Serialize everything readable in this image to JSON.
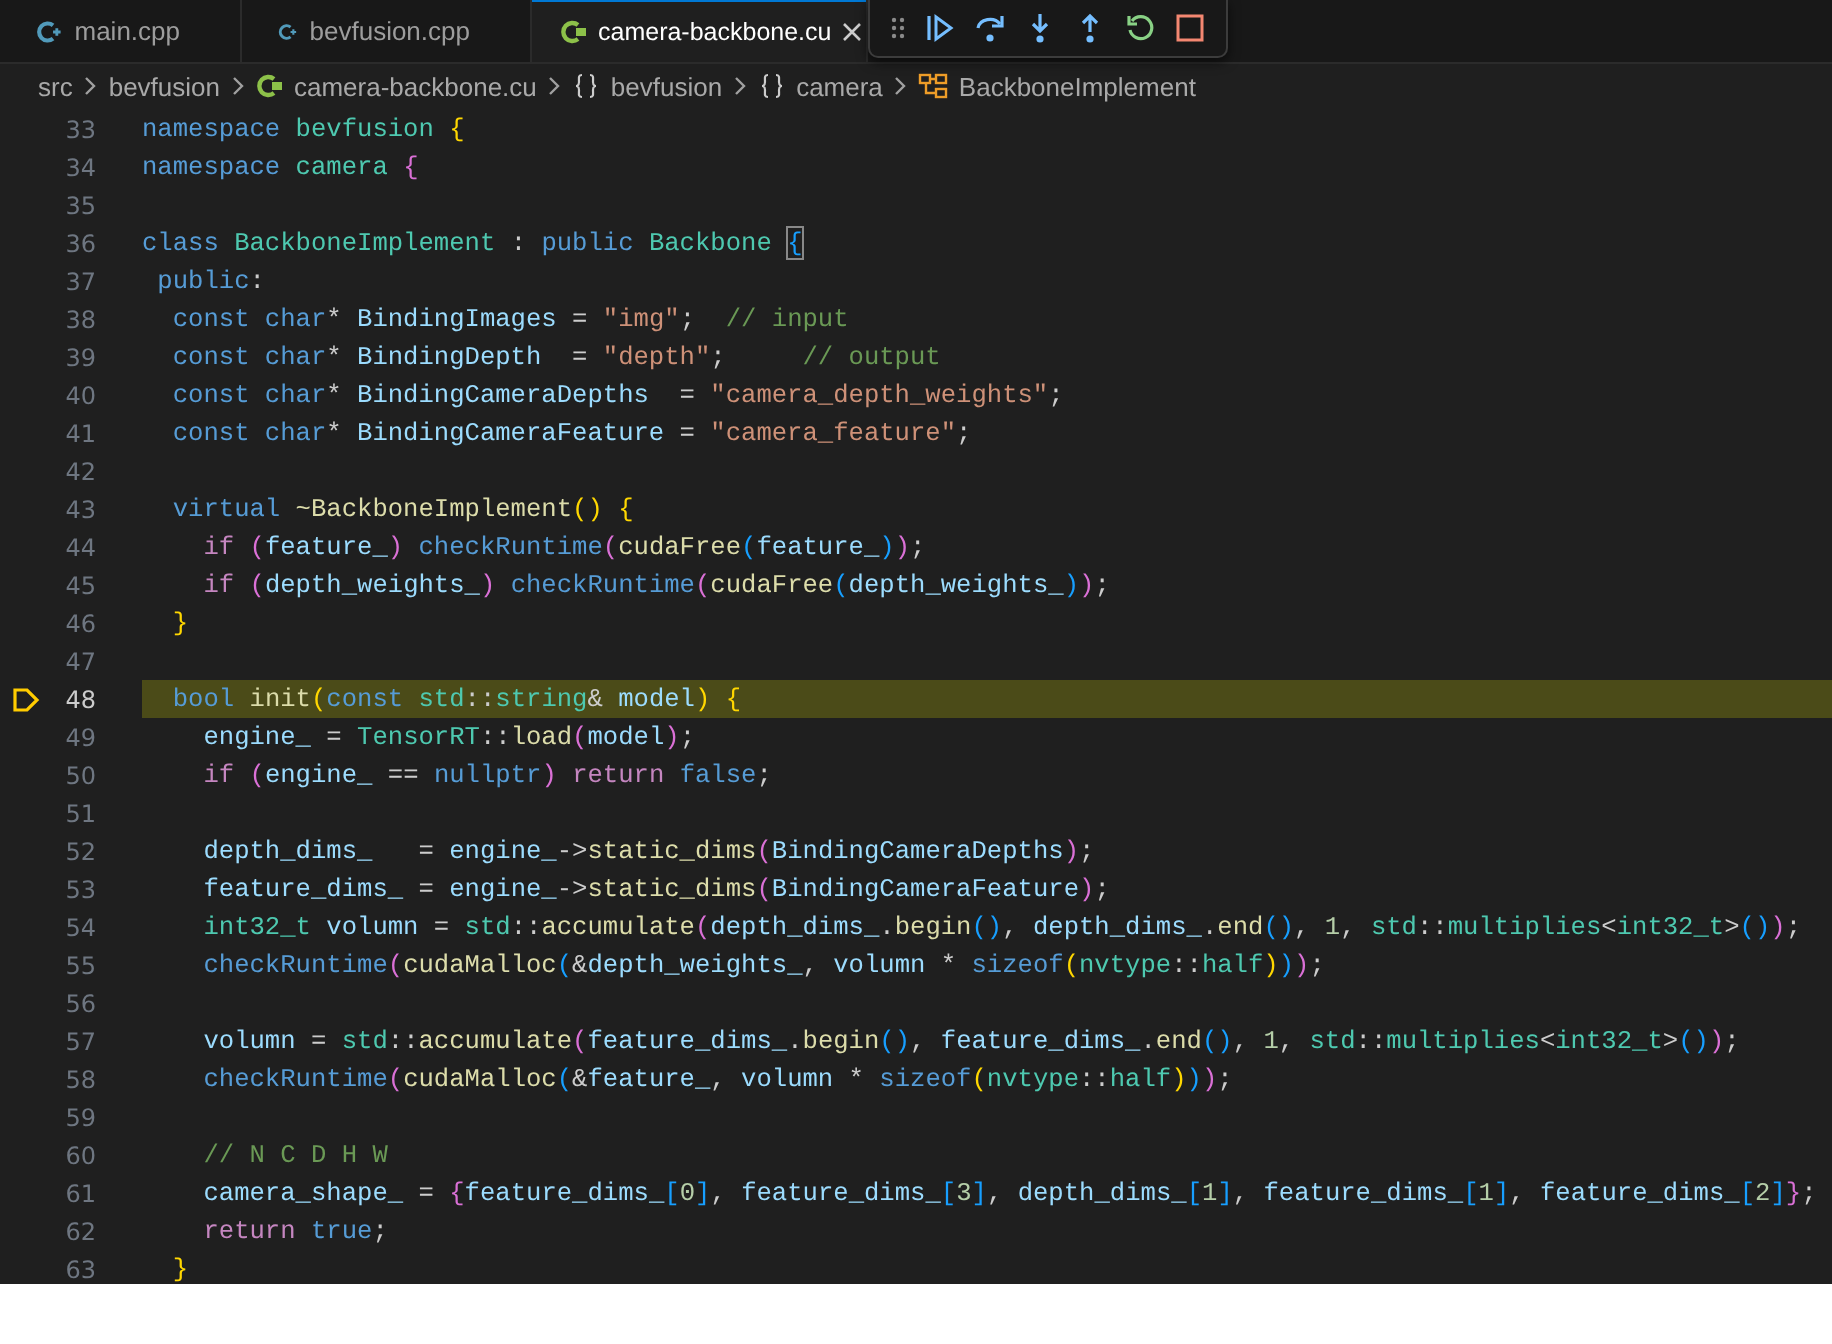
{
  "tabs": [
    {
      "label": "main.cpp",
      "kind": "cpp",
      "selected": false
    },
    {
      "label": "bevfusion.cpp",
      "kind": "cpp",
      "selected": false
    },
    {
      "label": "camera-backbone.cu",
      "kind": "cuda",
      "selected": true
    }
  ],
  "debug_toolbar": [
    {
      "kind": "continue"
    },
    {
      "kind": "step_over"
    },
    {
      "kind": "step_into"
    },
    {
      "kind": "step_out"
    },
    {
      "kind": "restart"
    },
    {
      "kind": "stop"
    }
  ],
  "breadcrumbs": [
    {
      "label": "src",
      "kind": "folder"
    },
    {
      "label": "bevfusion",
      "kind": "folder"
    },
    {
      "label": "camera-backbone.cu",
      "kind": "cuda"
    },
    {
      "label": "bevfusion",
      "kind": "namespace"
    },
    {
      "label": "camera",
      "kind": "namespace"
    },
    {
      "label": "BackboneImplement",
      "kind": "class"
    }
  ],
  "lines": [
    {
      "number": "33",
      "current": false,
      "tokens": [
        {
          "kind": "kw",
          "text": "namespace "
        },
        {
          "kind": "type",
          "text": "bevfusion "
        },
        {
          "kind": "b1",
          "text": "{"
        }
      ]
    },
    {
      "number": "34",
      "current": false,
      "tokens": [
        {
          "kind": "kw",
          "text": "namespace "
        },
        {
          "kind": "type",
          "text": "camera "
        },
        {
          "kind": "b2",
          "text": "{"
        }
      ]
    },
    {
      "number": "35",
      "current": false
    },
    {
      "number": "36",
      "current": false,
      "tokens": [
        {
          "kind": "kw",
          "text": "class "
        },
        {
          "kind": "type",
          "text": "BackboneImplement"
        },
        {
          "kind": "p",
          "text": " : "
        },
        {
          "kind": "kw",
          "text": "public "
        },
        {
          "kind": "type",
          "text": "Backbone "
        },
        {
          "kind": "bm",
          "text": "{"
        }
      ]
    },
    {
      "number": "37",
      "current": false,
      "tokens": [
        {
          "kind": "kw",
          "text": " public"
        },
        {
          "kind": "p",
          "text": ":"
        }
      ]
    },
    {
      "number": "38",
      "current": false,
      "tokens": [
        {
          "kind": "kw",
          "text": "  const char"
        },
        {
          "kind": "p",
          "text": "* "
        },
        {
          "kind": "var",
          "text": "BindingImages"
        },
        {
          "kind": "p",
          "text": " = "
        },
        {
          "kind": "str",
          "text": "\"img\""
        },
        {
          "kind": "p",
          "text": ";  "
        },
        {
          "kind": "com",
          "text": "// input"
        }
      ]
    },
    {
      "number": "39",
      "current": false,
      "tokens": [
        {
          "kind": "kw",
          "text": "  const char"
        },
        {
          "kind": "p",
          "text": "* "
        },
        {
          "kind": "var",
          "text": "BindingDepth"
        },
        {
          "kind": "p",
          "text": "  = "
        },
        {
          "kind": "str",
          "text": "\"depth\""
        },
        {
          "kind": "p",
          "text": ";     "
        },
        {
          "kind": "com",
          "text": "// output"
        }
      ]
    },
    {
      "number": "40",
      "current": false,
      "tokens": [
        {
          "kind": "kw",
          "text": "  const char"
        },
        {
          "kind": "p",
          "text": "* "
        },
        {
          "kind": "var",
          "text": "BindingCameraDepths"
        },
        {
          "kind": "p",
          "text": "  = "
        },
        {
          "kind": "str",
          "text": "\"camera_depth_weights\""
        },
        {
          "kind": "p",
          "text": ";"
        }
      ]
    },
    {
      "number": "41",
      "current": false,
      "tokens": [
        {
          "kind": "kw",
          "text": "  const char"
        },
        {
          "kind": "p",
          "text": "* "
        },
        {
          "kind": "var",
          "text": "BindingCameraFeature"
        },
        {
          "kind": "p",
          "text": " = "
        },
        {
          "kind": "str",
          "text": "\"camera_feature\""
        },
        {
          "kind": "p",
          "text": ";"
        }
      ]
    },
    {
      "number": "42",
      "current": false
    },
    {
      "number": "43",
      "current": false,
      "tokens": [
        {
          "kind": "kw",
          "text": "  virtual "
        },
        {
          "kind": "fn",
          "text": "~BackboneImplement"
        },
        {
          "kind": "b1",
          "text": "() {"
        }
      ]
    },
    {
      "number": "44",
      "current": false,
      "tokens": [
        {
          "kind": "ctrl",
          "text": "    if "
        },
        {
          "kind": "b2",
          "text": "("
        },
        {
          "kind": "var",
          "text": "feature_"
        },
        {
          "kind": "b2",
          "text": ") "
        },
        {
          "kind": "kw",
          "text": "checkRuntime"
        },
        {
          "kind": "b2",
          "text": "("
        },
        {
          "kind": "fn",
          "text": "cudaFree"
        },
        {
          "kind": "b3",
          "text": "("
        },
        {
          "kind": "var",
          "text": "feature_"
        },
        {
          "kind": "b3",
          "text": ")"
        },
        {
          "kind": "b2",
          "text": ")"
        },
        {
          "kind": "p",
          "text": ";"
        }
      ]
    },
    {
      "number": "45",
      "current": false,
      "tokens": [
        {
          "kind": "ctrl",
          "text": "    if "
        },
        {
          "kind": "b2",
          "text": "("
        },
        {
          "kind": "var",
          "text": "depth_weights_"
        },
        {
          "kind": "b2",
          "text": ") "
        },
        {
          "kind": "kw",
          "text": "checkRuntime"
        },
        {
          "kind": "b2",
          "text": "("
        },
        {
          "kind": "fn",
          "text": "cudaFree"
        },
        {
          "kind": "b3",
          "text": "("
        },
        {
          "kind": "var",
          "text": "depth_weights_"
        },
        {
          "kind": "b3",
          "text": ")"
        },
        {
          "kind": "b2",
          "text": ")"
        },
        {
          "kind": "p",
          "text": ";"
        }
      ]
    },
    {
      "number": "46",
      "current": false,
      "tokens": [
        {
          "kind": "b1",
          "text": "  }"
        }
      ]
    },
    {
      "number": "47",
      "current": false
    },
    {
      "number": "48",
      "current": true,
      "tokens": [
        {
          "kind": "kw",
          "text": "  bool "
        },
        {
          "kind": "fn",
          "text": "init"
        },
        {
          "kind": "b1",
          "text": "("
        },
        {
          "kind": "kw",
          "text": "const "
        },
        {
          "kind": "type",
          "text": "std"
        },
        {
          "kind": "p",
          "text": "::"
        },
        {
          "kind": "type",
          "text": "string"
        },
        {
          "kind": "p",
          "text": "& "
        },
        {
          "kind": "var",
          "text": "model"
        },
        {
          "kind": "b1",
          "text": ") {"
        }
      ]
    },
    {
      "number": "49",
      "current": false,
      "tokens": [
        {
          "kind": "var",
          "text": "    engine_"
        },
        {
          "kind": "p",
          "text": " = "
        },
        {
          "kind": "type",
          "text": "TensorRT"
        },
        {
          "kind": "p",
          "text": "::"
        },
        {
          "kind": "fn",
          "text": "load"
        },
        {
          "kind": "b2",
          "text": "("
        },
        {
          "kind": "var",
          "text": "model"
        },
        {
          "kind": "b2",
          "text": ")"
        },
        {
          "kind": "p",
          "text": ";"
        }
      ]
    },
    {
      "number": "50",
      "current": false,
      "tokens": [
        {
          "kind": "ctrl",
          "text": "    if "
        },
        {
          "kind": "b2",
          "text": "("
        },
        {
          "kind": "var",
          "text": "engine_"
        },
        {
          "kind": "p",
          "text": " == "
        },
        {
          "kind": "kw",
          "text": "nullptr"
        },
        {
          "kind": "b2",
          "text": ") "
        },
        {
          "kind": "ctrl",
          "text": "return "
        },
        {
          "kind": "kw",
          "text": "false"
        },
        {
          "kind": "p",
          "text": ";"
        }
      ]
    },
    {
      "number": "51",
      "current": false
    },
    {
      "number": "52",
      "current": false,
      "tokens": [
        {
          "kind": "var",
          "text": "    depth_dims_"
        },
        {
          "kind": "p",
          "text": "   = "
        },
        {
          "kind": "var",
          "text": "engine_"
        },
        {
          "kind": "p",
          "text": "->"
        },
        {
          "kind": "fn",
          "text": "static_dims"
        },
        {
          "kind": "b2",
          "text": "("
        },
        {
          "kind": "var",
          "text": "BindingCameraDepths"
        },
        {
          "kind": "b2",
          "text": ")"
        },
        {
          "kind": "p",
          "text": ";"
        }
      ]
    },
    {
      "number": "53",
      "current": false,
      "tokens": [
        {
          "kind": "var",
          "text": "    feature_dims_"
        },
        {
          "kind": "p",
          "text": " = "
        },
        {
          "kind": "var",
          "text": "engine_"
        },
        {
          "kind": "p",
          "text": "->"
        },
        {
          "kind": "fn",
          "text": "static_dims"
        },
        {
          "kind": "b2",
          "text": "("
        },
        {
          "kind": "var",
          "text": "BindingCameraFeature"
        },
        {
          "kind": "b2",
          "text": ")"
        },
        {
          "kind": "p",
          "text": ";"
        }
      ]
    },
    {
      "number": "54",
      "current": false,
      "tokens": [
        {
          "kind": "type",
          "text": "    int32_t "
        },
        {
          "kind": "var",
          "text": "volumn"
        },
        {
          "kind": "p",
          "text": " = "
        },
        {
          "kind": "type",
          "text": "std"
        },
        {
          "kind": "p",
          "text": "::"
        },
        {
          "kind": "fn",
          "text": "accumulate"
        },
        {
          "kind": "b2",
          "text": "("
        },
        {
          "kind": "var",
          "text": "depth_dims_"
        },
        {
          "kind": "p",
          "text": "."
        },
        {
          "kind": "fn",
          "text": "begin"
        },
        {
          "kind": "b3",
          "text": "()"
        },
        {
          "kind": "p",
          "text": ", "
        },
        {
          "kind": "var",
          "text": "depth_dims_"
        },
        {
          "kind": "p",
          "text": "."
        },
        {
          "kind": "fn",
          "text": "end"
        },
        {
          "kind": "b3",
          "text": "()"
        },
        {
          "kind": "p",
          "text": ", "
        },
        {
          "kind": "num",
          "text": "1"
        },
        {
          "kind": "p",
          "text": ", "
        },
        {
          "kind": "type",
          "text": "std"
        },
        {
          "kind": "p",
          "text": "::"
        },
        {
          "kind": "type",
          "text": "multiplies"
        },
        {
          "kind": "p",
          "text": "<"
        },
        {
          "kind": "type",
          "text": "int32_t"
        },
        {
          "kind": "p",
          "text": ">"
        },
        {
          "kind": "b3",
          "text": "()"
        },
        {
          "kind": "b2",
          "text": ")"
        },
        {
          "kind": "p",
          "text": ";"
        }
      ]
    },
    {
      "number": "55",
      "current": false,
      "tokens": [
        {
          "kind": "kw",
          "text": "    checkRuntime"
        },
        {
          "kind": "b2",
          "text": "("
        },
        {
          "kind": "fn",
          "text": "cudaMalloc"
        },
        {
          "kind": "b3",
          "text": "("
        },
        {
          "kind": "p",
          "text": "&"
        },
        {
          "kind": "var",
          "text": "depth_weights_"
        },
        {
          "kind": "p",
          "text": ", "
        },
        {
          "kind": "var",
          "text": "volumn"
        },
        {
          "kind": "p",
          "text": " * "
        },
        {
          "kind": "kw",
          "text": "sizeof"
        },
        {
          "kind": "b1",
          "text": "("
        },
        {
          "kind": "type",
          "text": "nvtype"
        },
        {
          "kind": "p",
          "text": "::"
        },
        {
          "kind": "type",
          "text": "half"
        },
        {
          "kind": "b1",
          "text": ")"
        },
        {
          "kind": "b3",
          "text": ")"
        },
        {
          "kind": "b2",
          "text": ")"
        },
        {
          "kind": "p",
          "text": ";"
        }
      ]
    },
    {
      "number": "56",
      "current": false
    },
    {
      "number": "57",
      "current": false,
      "tokens": [
        {
          "kind": "var",
          "text": "    volumn"
        },
        {
          "kind": "p",
          "text": " = "
        },
        {
          "kind": "type",
          "text": "std"
        },
        {
          "kind": "p",
          "text": "::"
        },
        {
          "kind": "fn",
          "text": "accumulate"
        },
        {
          "kind": "b2",
          "text": "("
        },
        {
          "kind": "var",
          "text": "feature_dims_"
        },
        {
          "kind": "p",
          "text": "."
        },
        {
          "kind": "fn",
          "text": "begin"
        },
        {
          "kind": "b3",
          "text": "()"
        },
        {
          "kind": "p",
          "text": ", "
        },
        {
          "kind": "var",
          "text": "feature_dims_"
        },
        {
          "kind": "p",
          "text": "."
        },
        {
          "kind": "fn",
          "text": "end"
        },
        {
          "kind": "b3",
          "text": "()"
        },
        {
          "kind": "p",
          "text": ", "
        },
        {
          "kind": "num",
          "text": "1"
        },
        {
          "kind": "p",
          "text": ", "
        },
        {
          "kind": "type",
          "text": "std"
        },
        {
          "kind": "p",
          "text": "::"
        },
        {
          "kind": "type",
          "text": "multiplies"
        },
        {
          "kind": "p",
          "text": "<"
        },
        {
          "kind": "type",
          "text": "int32_t"
        },
        {
          "kind": "p",
          "text": ">"
        },
        {
          "kind": "b3",
          "text": "()"
        },
        {
          "kind": "b2",
          "text": ")"
        },
        {
          "kind": "p",
          "text": ";"
        }
      ]
    },
    {
      "number": "58",
      "current": false,
      "tokens": [
        {
          "kind": "kw",
          "text": "    checkRuntime"
        },
        {
          "kind": "b2",
          "text": "("
        },
        {
          "kind": "fn",
          "text": "cudaMalloc"
        },
        {
          "kind": "b3",
          "text": "("
        },
        {
          "kind": "p",
          "text": "&"
        },
        {
          "kind": "var",
          "text": "feature_"
        },
        {
          "kind": "p",
          "text": ", "
        },
        {
          "kind": "var",
          "text": "volumn"
        },
        {
          "kind": "p",
          "text": " * "
        },
        {
          "kind": "kw",
          "text": "sizeof"
        },
        {
          "kind": "b1",
          "text": "("
        },
        {
          "kind": "type",
          "text": "nvtype"
        },
        {
          "kind": "p",
          "text": "::"
        },
        {
          "kind": "type",
          "text": "half"
        },
        {
          "kind": "b1",
          "text": ")"
        },
        {
          "kind": "b3",
          "text": ")"
        },
        {
          "kind": "b2",
          "text": ")"
        },
        {
          "kind": "p",
          "text": ";"
        }
      ]
    },
    {
      "number": "59",
      "current": false
    },
    {
      "number": "60",
      "current": false,
      "tokens": [
        {
          "kind": "com",
          "text": "    // N C D H W"
        }
      ]
    },
    {
      "number": "61",
      "current": false,
      "tokens": [
        {
          "kind": "var",
          "text": "    camera_shape_"
        },
        {
          "kind": "p",
          "text": " = "
        },
        {
          "kind": "b2",
          "text": "{"
        },
        {
          "kind": "var",
          "text": "feature_dims_"
        },
        {
          "kind": "b3",
          "text": "["
        },
        {
          "kind": "num",
          "text": "0"
        },
        {
          "kind": "b3",
          "text": "]"
        },
        {
          "kind": "p",
          "text": ", "
        },
        {
          "kind": "var",
          "text": "feature_dims_"
        },
        {
          "kind": "b3",
          "text": "["
        },
        {
          "kind": "num",
          "text": "3"
        },
        {
          "kind": "b3",
          "text": "]"
        },
        {
          "kind": "p",
          "text": ", "
        },
        {
          "kind": "var",
          "text": "depth_dims_"
        },
        {
          "kind": "b3",
          "text": "["
        },
        {
          "kind": "num",
          "text": "1"
        },
        {
          "kind": "b3",
          "text": "]"
        },
        {
          "kind": "p",
          "text": ", "
        },
        {
          "kind": "var",
          "text": "feature_dims_"
        },
        {
          "kind": "b3",
          "text": "["
        },
        {
          "kind": "num",
          "text": "1"
        },
        {
          "kind": "b3",
          "text": "]"
        },
        {
          "kind": "p",
          "text": ", "
        },
        {
          "kind": "var",
          "text": "feature_dims_"
        },
        {
          "kind": "b3",
          "text": "["
        },
        {
          "kind": "num",
          "text": "2"
        },
        {
          "kind": "b3",
          "text": "]"
        },
        {
          "kind": "b2",
          "text": "}"
        },
        {
          "kind": "p",
          "text": ";"
        }
      ]
    },
    {
      "number": "62",
      "current": false,
      "tokens": [
        {
          "kind": "ctrl",
          "text": "    return "
        },
        {
          "kind": "kw",
          "text": "true"
        },
        {
          "kind": "p",
          "text": ";"
        }
      ]
    },
    {
      "number": "63",
      "current": false,
      "tokens": [
        {
          "kind": "b1",
          "text": "  }"
        }
      ]
    }
  ]
}
